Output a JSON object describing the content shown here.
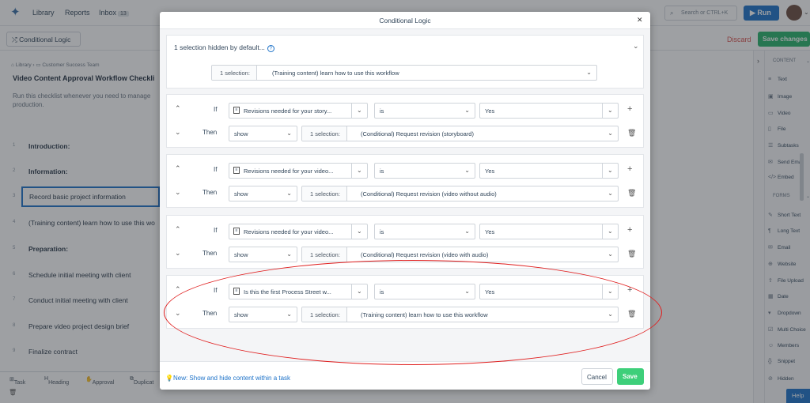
{
  "nav": {
    "library": "Library",
    "reports": "Reports",
    "inbox": "Inbox",
    "inbox_count": "13"
  },
  "search": {
    "placeholder": "Search or CTRL+K"
  },
  "run_label": "Run",
  "conditional_tab": "Conditional Logic",
  "discard": "Discard",
  "save_changes": "Save changes",
  "breadcrumb": {
    "library": "Library",
    "team": "Customer Success Team"
  },
  "workflow": {
    "title": "Video Content Approval Workflow Checkli",
    "description": "Run this checklist whenever you need to manage production."
  },
  "tasks": [
    {
      "num": "1",
      "label": "Introduction:"
    },
    {
      "num": "2",
      "label": "Information:"
    },
    {
      "num": "3",
      "label": "Record basic project information"
    },
    {
      "num": "4",
      "label": "(Training content) learn how to use this wo"
    },
    {
      "num": "5",
      "label": "Preparation:"
    },
    {
      "num": "6",
      "label": "Schedule initial meeting with client"
    },
    {
      "num": "7",
      "label": "Conduct initial meeting with client"
    },
    {
      "num": "8",
      "label": "Prepare video project design brief"
    },
    {
      "num": "9",
      "label": "Finalize contract"
    }
  ],
  "bottombar": {
    "task": "Task",
    "heading": "Heading",
    "approval": "Approval",
    "duplicate": "Duplicat"
  },
  "sidebar": {
    "content_header": "CONTENT",
    "content_items": [
      "Text",
      "Image",
      "Video",
      "File",
      "Subtasks",
      "Send Email",
      "Embed"
    ],
    "forms_header": "FORMS",
    "form_items": [
      "Short Text",
      "Long Text",
      "Email",
      "Website",
      "File Upload",
      "Date",
      "Dropdown",
      "Multi Choice",
      "Members",
      "Snippet",
      "Hidden"
    ]
  },
  "help": "Help",
  "modal": {
    "title": "Conditional Logic",
    "hidden": {
      "text": "1 selection hidden by default...",
      "selection_prefix": "1 selection:",
      "selection_value": "(Training content) learn how to use this workflow"
    },
    "if_label": "If",
    "then_label": "Then",
    "rules": [
      {
        "field": "Revisions needed for your story...",
        "operator": "is",
        "value": "Yes",
        "action": "show",
        "sel_prefix": "1 selection:",
        "target": "(Conditional) Request revision (storyboard)"
      },
      {
        "field": "Revisions needed for your video...",
        "operator": "is",
        "value": "Yes",
        "action": "show",
        "sel_prefix": "1 selection:",
        "target": "(Conditional) Request revision (video without audio)"
      },
      {
        "field": "Revisions needed for your video...",
        "operator": "is",
        "value": "Yes",
        "action": "show",
        "sel_prefix": "1 selection:",
        "target": "(Conditional) Request revision (video with audio)"
      },
      {
        "field": "Is this the first Process Street w...",
        "operator": "is",
        "value": "Yes",
        "action": "show",
        "sel_prefix": "1 selection:",
        "target": "(Training content) learn how to use this workflow"
      }
    ],
    "footer_link": "New: Show and hide content within a task",
    "cancel": "Cancel",
    "save": "Save"
  },
  "colors": {
    "accent": "#1d72c8",
    "save_green": "#27b36a",
    "annotation_red": "#e02020",
    "discard_red": "#d9534f"
  }
}
